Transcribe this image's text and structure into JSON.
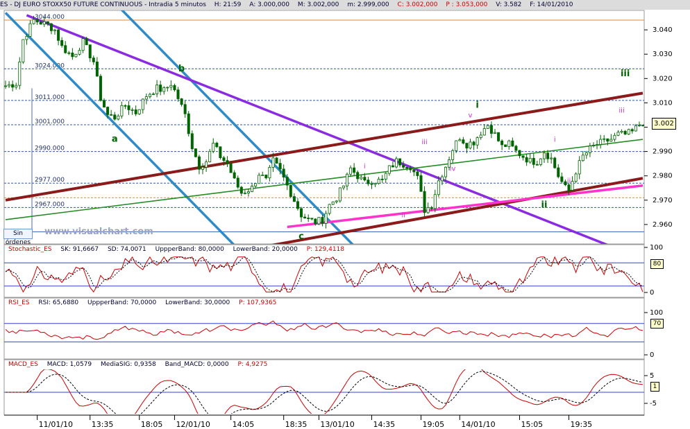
{
  "title_bar": {
    "symbol": "ES - DJ EURO STOXX50 FUTURE CONTINUOUS - Intradia 5 minutos",
    "hour": "H: 21:59",
    "open": "A: 3.000,000",
    "max": "M: 3.002,000",
    "min": "m: 2.999,000",
    "close": "C: 3.002,000",
    "p": "P : 3.053,000",
    "volume": "V: 3.582",
    "date": "F: 14/01/2010"
  },
  "indicators": {
    "stochastic": {
      "name": "Stochastic_ES",
      "sk": "SK: 91,6667",
      "sd": "SD: 74,0071",
      "upper": "UppperBand: 80,0000",
      "lower": "LowerBand: 20,0000",
      "p": "P: 129,4118",
      "current_tag": "80",
      "scale_top": "100",
      "scale_bottom": "0"
    },
    "rsi": {
      "name": "RSI_ES",
      "rsi": "RSI: 65,6880",
      "upper": "UppperBand: 70,0000",
      "lower": "LowerBand: 30,0000",
      "p": "P: 107,9365",
      "current_tag": "70",
      "scale_top": "100",
      "scale_bottom": "0"
    },
    "macd": {
      "name": "MACD_ES",
      "macd": "MACD: 1,0579",
      "signal": "MediaSIG: 0,9358",
      "band": "Band_MACD: 0,0000",
      "p": "P: 4,9275",
      "current_tag": "1",
      "scale_top": "5",
      "scale_bottom": "-5"
    }
  },
  "sin_ordenes": "Sin órdenes",
  "watermark": "www.visualchart.com",
  "current_price": "3.002",
  "chart_data": {
    "type": "candlestick",
    "title": "ES - DJ EURO STOXX50 FUTURE CONTINUOUS - Intradia 5 minutos",
    "ylim": [
      2952,
      3048
    ],
    "y_ticks": [
      "3.040",
      "3.030",
      "3.020",
      "3.010",
      "3.000",
      "2.990",
      "2.980",
      "2.970",
      "2.960"
    ],
    "x_ticks": [
      "11/01/10",
      "13:35",
      "18:05",
      "12/01/10",
      "14:05",
      "18:35",
      "13/01/10",
      "14:35",
      "19:05",
      "14/01/10",
      "15:05",
      "19:35"
    ],
    "price_path": [
      [
        0,
        3017
      ],
      [
        3,
        3018
      ],
      [
        5,
        3036
      ],
      [
        8,
        3044
      ],
      [
        10,
        3043
      ],
      [
        12,
        3042
      ],
      [
        14,
        3040
      ],
      [
        16,
        3033
      ],
      [
        19,
        3029
      ],
      [
        22,
        3035
      ],
      [
        25,
        3027
      ],
      [
        27,
        3012
      ],
      [
        29,
        3005
      ],
      [
        31,
        3004
      ],
      [
        34,
        3009
      ],
      [
        37,
        3006
      ],
      [
        40,
        3013
      ],
      [
        43,
        3016
      ],
      [
        45,
        3015
      ],
      [
        47,
        3018
      ],
      [
        49,
        3012
      ],
      [
        51,
        3005
      ],
      [
        53,
        2992
      ],
      [
        55,
        2984
      ],
      [
        57,
        2986
      ],
      [
        59,
        2993
      ],
      [
        61,
        2988
      ],
      [
        63,
        2985
      ],
      [
        65,
        2978
      ],
      [
        67,
        2973
      ],
      [
        70,
        2975
      ],
      [
        72,
        2981
      ],
      [
        74,
        2978
      ],
      [
        76,
        2986
      ],
      [
        78,
        2982
      ],
      [
        80,
        2976
      ],
      [
        82,
        2970
      ],
      [
        84,
        2964
      ],
      [
        86,
        2962
      ],
      [
        88,
        2961
      ],
      [
        90,
        2962
      ],
      [
        92,
        2968
      ],
      [
        94,
        2971
      ],
      [
        96,
        2976
      ],
      [
        98,
        2983
      ],
      [
        100,
        2980
      ],
      [
        102,
        2977
      ],
      [
        104,
        2978
      ],
      [
        107,
        2978
      ],
      [
        109,
        2983
      ],
      [
        111,
        2986
      ],
      [
        113,
        2985
      ],
      [
        115,
        2984
      ],
      [
        117,
        2979
      ],
      [
        119,
        2966
      ],
      [
        121,
        2968
      ],
      [
        123,
        2978
      ],
      [
        125,
        2984
      ],
      [
        127,
        2991
      ],
      [
        129,
        2996
      ],
      [
        131,
        2993
      ],
      [
        133,
        2994
      ],
      [
        135,
        2998
      ],
      [
        137,
        3001
      ],
      [
        139,
        2997
      ],
      [
        141,
        2992
      ],
      [
        143,
        2993
      ],
      [
        145,
        2990
      ],
      [
        147,
        2988
      ],
      [
        149,
        2986
      ],
      [
        151,
        2986
      ],
      [
        153,
        2990
      ],
      [
        155,
        2987
      ],
      [
        157,
        2980
      ],
      [
        159,
        2975
      ],
      [
        160,
        2974
      ],
      [
        162,
        2982
      ],
      [
        164,
        2988
      ],
      [
        166,
        2991
      ],
      [
        168,
        2993
      ],
      [
        170,
        2994
      ],
      [
        172,
        2995
      ],
      [
        174,
        2997
      ],
      [
        176,
        2997
      ],
      [
        178,
        2998
      ],
      [
        180,
        3001
      ],
      [
        181,
        3002
      ]
    ],
    "horizontal_levels": [
      {
        "label": "3044.000",
        "value": 3044
      },
      {
        "label": "3024.000",
        "value": 3024
      },
      {
        "label": "3011.000",
        "value": 3011
      },
      {
        "label": "3001.000",
        "value": 3001
      },
      {
        "label": "2990.000",
        "value": 2990
      },
      {
        "label": "2977.000",
        "value": 2977
      },
      {
        "label": "2967.000",
        "value": 2967
      }
    ],
    "wave_labels": [
      {
        "text": "a",
        "x": 31,
        "y": 2994,
        "color": "#006400"
      },
      {
        "text": "b",
        "x": 50,
        "y": 3023,
        "color": "#006400"
      },
      {
        "text": "c",
        "x": 84,
        "y": 2954,
        "color": "#006400"
      },
      {
        "text": "i",
        "x": 102,
        "y": 2983,
        "color": "#cc33cc"
      },
      {
        "text": "ii",
        "x": 113,
        "y": 2963,
        "color": "#cc33cc"
      },
      {
        "text": "iii",
        "x": 119,
        "y": 2993,
        "color": "#cc33cc"
      },
      {
        "text": "iv",
        "x": 127,
        "y": 2982,
        "color": "#cc33cc"
      },
      {
        "text": "v",
        "x": 132,
        "y": 3004,
        "color": "#cc33cc"
      },
      {
        "text": "i",
        "x": 134,
        "y": 3008,
        "color": "#006400"
      },
      {
        "text": "i",
        "x": 156,
        "y": 2994,
        "color": "#cc33cc"
      },
      {
        "text": "ii",
        "x": 160,
        "y": 2977,
        "color": "#cc33cc"
      },
      {
        "text": "ii",
        "x": 153,
        "y": 2967,
        "color": "#006400"
      },
      {
        "text": "iii",
        "x": 176,
        "y": 3021,
        "color": "#006400"
      },
      {
        "text": "iii",
        "x": 175,
        "y": 3006,
        "color": "#cc33cc"
      }
    ]
  },
  "colors": {
    "candles": "#006400",
    "channel_blue": "#2e8bc7",
    "channel_purple": "#8a2be2",
    "channel_brown": "#8b1a1a",
    "channel_magenta": "#ff33cc",
    "trend_green": "#228b22",
    "level_dashed": "#3355aa",
    "stoch_line": "#cc0000",
    "band_line": "#3344cc"
  }
}
